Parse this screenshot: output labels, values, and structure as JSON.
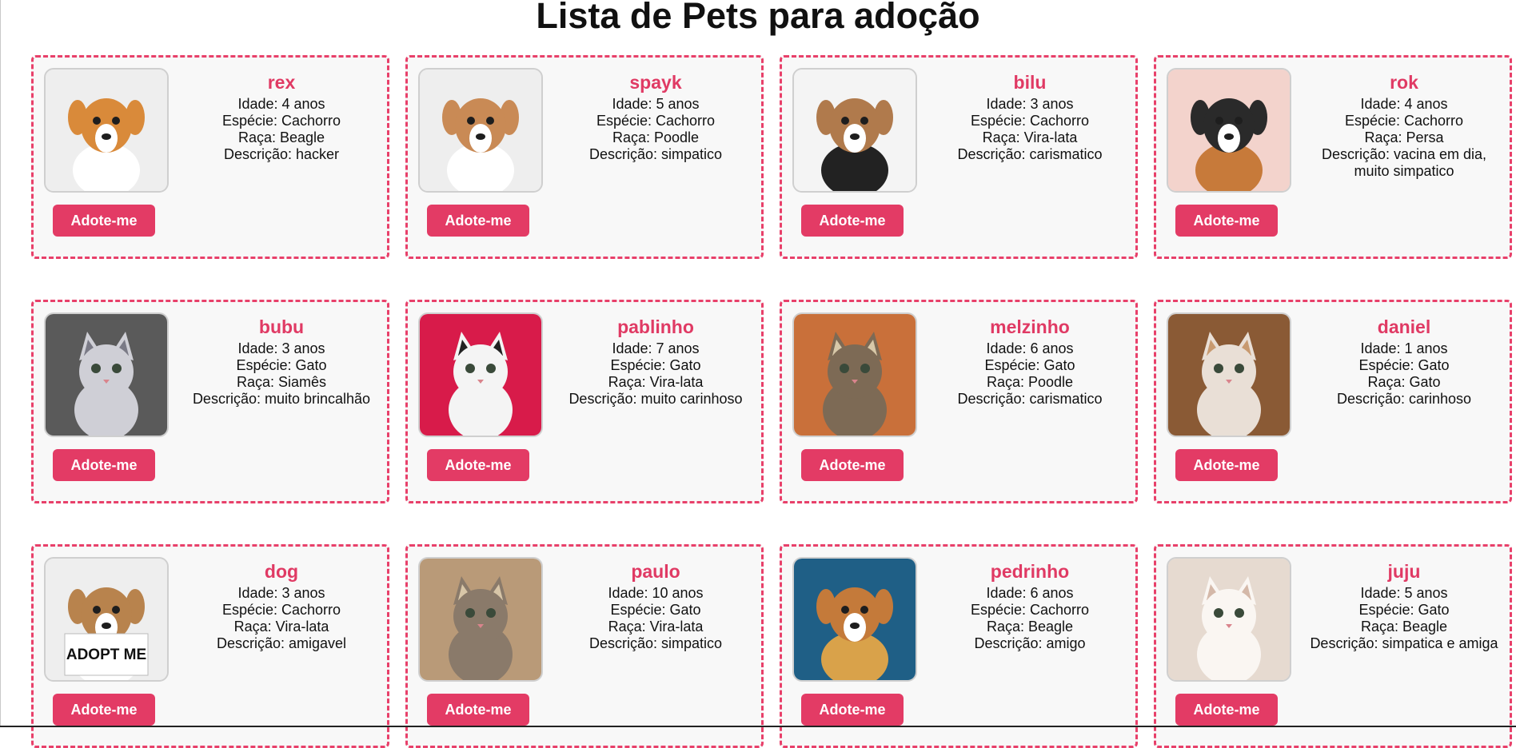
{
  "page": {
    "title": "Lista de Pets para adoção"
  },
  "labels": {
    "idade": "Idade: ",
    "especie": "Espécie: ",
    "raca": "Raça: ",
    "descricao": "Descrição: "
  },
  "pets": [
    {
      "name": "rex",
      "idade": "4 anos",
      "especie": "Cachorro",
      "raca": "Beagle",
      "descricao": "hacker",
      "button": "Adote-me",
      "photo": {
        "bg": "#eeeeee",
        "animal": "#d98a3a",
        "accent": "#ffffff",
        "kind": "dog"
      }
    },
    {
      "name": "spayk",
      "idade": "5 anos",
      "especie": "Cachorro",
      "raca": "Poodle",
      "descricao": "simpatico",
      "button": "Adote-me",
      "photo": {
        "bg": "#eeeeee",
        "animal": "#c98a55",
        "accent": "#ffffff",
        "kind": "dog"
      }
    },
    {
      "name": "bilu",
      "idade": "3 anos",
      "especie": "Cachorro",
      "raca": "Vira-lata",
      "descricao": "carismatico",
      "button": "Adote-me",
      "photo": {
        "bg": "#f4f4f4",
        "animal": "#b07a4c",
        "accent": "#222222",
        "kind": "dog"
      }
    },
    {
      "name": "rok",
      "idade": "4 anos",
      "especie": "Cachorro",
      "raca": "Persa",
      "descricao": "vacina em dia, muito simpatico",
      "button": "Adote-me",
      "photo": {
        "bg": "#f3d3cc",
        "animal": "#2a2a2a",
        "accent": "#c77a3a",
        "kind": "dog"
      }
    },
    {
      "name": "bubu",
      "idade": "3 anos",
      "especie": "Gato",
      "raca": "Siamês",
      "descricao": "muito brincalhão",
      "button": "Adote-me",
      "photo": {
        "bg": "#5a5a5a",
        "animal": "#cfcfd6",
        "accent": "#7a7a86",
        "kind": "cat"
      }
    },
    {
      "name": "pablinho",
      "idade": "7 anos",
      "especie": "Gato",
      "raca": "Vira-lata",
      "descricao": "muito carinhoso",
      "button": "Adote-me",
      "photo": {
        "bg": "#d81b4a",
        "animal": "#f4f4f4",
        "accent": "#222222",
        "kind": "cat"
      }
    },
    {
      "name": "melzinho",
      "idade": "6 anos",
      "especie": "Gato",
      "raca": "Poodle",
      "descricao": "carismatico",
      "button": "Adote-me",
      "photo": {
        "bg": "#c9703a",
        "animal": "#7d6a55",
        "accent": "#d8c8a8",
        "kind": "cat"
      }
    },
    {
      "name": "daniel",
      "idade": "1 anos",
      "especie": "Gato",
      "raca": "Gato",
      "descricao": "carinhoso",
      "button": "Adote-me",
      "photo": {
        "bg": "#8a5a35",
        "animal": "#e9dfd6",
        "accent": "#c89a70",
        "kind": "cat"
      }
    },
    {
      "name": "dog",
      "idade": "3 anos",
      "especie": "Cachorro",
      "raca": "Vira-lata",
      "descricao": "amigavel",
      "button": "Adote-me",
      "photo": {
        "bg": "#eeeeee",
        "animal": "#b8834d",
        "accent": "#ffffff",
        "kind": "dog",
        "sign": "ADOPT ME"
      }
    },
    {
      "name": "paulo",
      "idade": "10 anos",
      "especie": "Gato",
      "raca": "Vira-lata",
      "descricao": "simpatico",
      "button": "Adote-me",
      "photo": {
        "bg": "#b99a78",
        "animal": "#8a7a6a",
        "accent": "#d8c6a8",
        "kind": "cat"
      }
    },
    {
      "name": "pedrinho",
      "idade": "6 anos",
      "especie": "Cachorro",
      "raca": "Beagle",
      "descricao": "amigo",
      "button": "Adote-me",
      "photo": {
        "bg": "#1f5f86",
        "animal": "#c47a3a",
        "accent": "#d9a24a",
        "kind": "dog"
      }
    },
    {
      "name": "juju",
      "idade": "5 anos",
      "especie": "Gato",
      "raca": "Beagle",
      "descricao": "simpatica e amiga",
      "button": "Adote-me",
      "photo": {
        "bg": "#e6dad0",
        "animal": "#faf6f2",
        "accent": "#d4b8a8",
        "kind": "cat"
      }
    }
  ]
}
